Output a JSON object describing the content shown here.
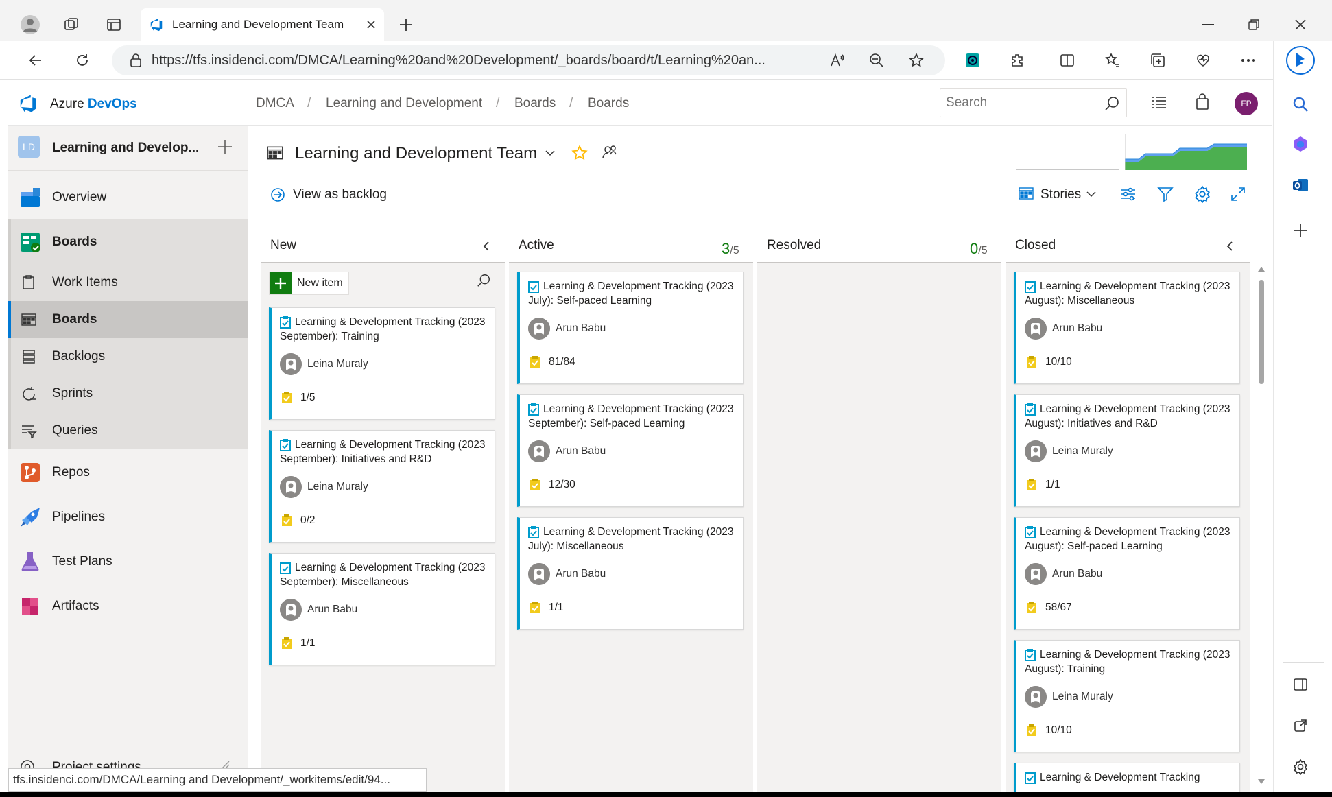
{
  "browser": {
    "tab_title": "Learning and Development Team",
    "url": "https://tfs.insidenci.com/DMCA/Learning%20and%20Development/_boards/board/t/Learning%20an...",
    "status_url": "tfs.insidenci.com/DMCA/Learning and Development/_workitems/edit/94..."
  },
  "header": {
    "brand_prefix": "Azure",
    "brand_name": "DevOps",
    "breadcrumbs": [
      "DMCA",
      "Learning and Development",
      "Boards",
      "Boards"
    ],
    "search_placeholder": "Search",
    "avatar_initials": "FP"
  },
  "project": {
    "initials": "LD",
    "name": "Learning and Develop..."
  },
  "nav": {
    "items": [
      {
        "label": "Overview"
      },
      {
        "label": "Boards"
      },
      {
        "label": "Work Items"
      },
      {
        "label": "Boards"
      },
      {
        "label": "Backlogs"
      },
      {
        "label": "Sprints"
      },
      {
        "label": "Queries"
      },
      {
        "label": "Repos"
      },
      {
        "label": "Pipelines"
      },
      {
        "label": "Test Plans"
      },
      {
        "label": "Artifacts"
      }
    ],
    "settings_label": "Project settings"
  },
  "board": {
    "team_title": "Learning and Development Team",
    "view_as_backlog": "View as backlog",
    "stories_label": "Stories",
    "new_item_label": "New item",
    "columns": [
      {
        "name": "New",
        "count": "",
        "limit": ""
      },
      {
        "name": "Active",
        "count": "3",
        "limit": "/5"
      },
      {
        "name": "Resolved",
        "count": "0",
        "limit": "/5"
      },
      {
        "name": "Closed",
        "count": "",
        "limit": ""
      }
    ],
    "cards_new": [
      {
        "title": "Learning & Development Tracking (2023 September): Training",
        "person": "Leina Muraly",
        "progress": "1/5"
      },
      {
        "title": "Learning & Development Tracking (2023 September): Initiatives and R&D",
        "person": "Leina Muraly",
        "progress": "0/2"
      },
      {
        "title": "Learning & Development Tracking (2023 September): Miscellaneous",
        "person": "Arun Babu",
        "progress": "1/1"
      }
    ],
    "cards_active": [
      {
        "title": "Learning & Development Tracking (2023 July): Self-paced Learning",
        "person": "Arun Babu",
        "progress": "81/84"
      },
      {
        "title": "Learning & Development Tracking (2023 September): Self-paced Learning",
        "person": "Arun Babu",
        "progress": "12/30"
      },
      {
        "title": "Learning & Development Tracking (2023 July): Miscellaneous",
        "person": "Arun Babu",
        "progress": "1/1"
      }
    ],
    "cards_closed": [
      {
        "title": "Learning & Development Tracking (2023 August): Miscellaneous",
        "person": "Arun Babu",
        "progress": "10/10"
      },
      {
        "title": "Learning & Development Tracking (2023 August): Initiatives and R&D",
        "person": "Leina Muraly",
        "progress": "1/1"
      },
      {
        "title": "Learning & Development Tracking (2023 August): Self-paced Learning",
        "person": "Arun Babu",
        "progress": "58/67"
      },
      {
        "title": "Learning & Development Tracking (2023 August): Training",
        "person": "Leina Muraly",
        "progress": "10/10"
      },
      {
        "title": "Learning & Development Tracking",
        "person": "",
        "progress": ""
      }
    ]
  },
  "colors": {
    "accent": "#0078d4",
    "story_blue": "#009ccc",
    "count_green": "#107c10",
    "new_item_green": "#107c10",
    "task_yellow": "#f2cb1d"
  }
}
